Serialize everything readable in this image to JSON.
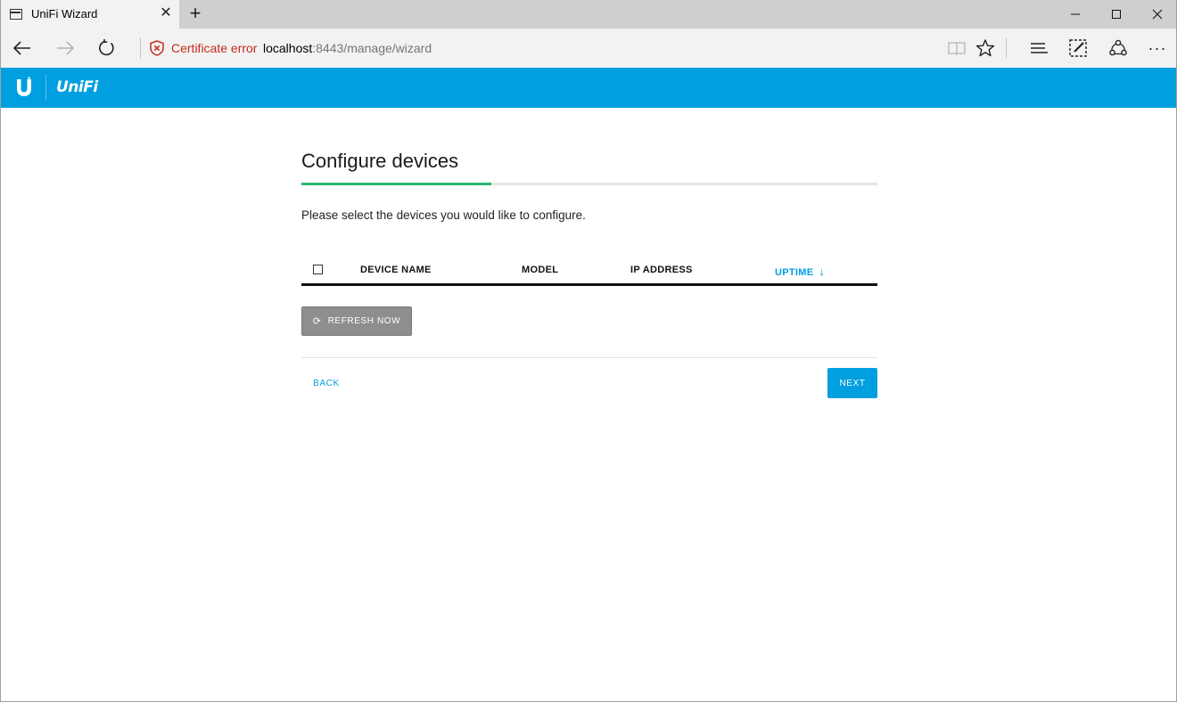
{
  "browser": {
    "tab_title": "UniFi Wizard",
    "tab_close": "✕",
    "new_tab": "+",
    "certificate_error": "Certificate error",
    "url_host": "localhost",
    "url_rest": ":8443/manage/wizard",
    "more": "···"
  },
  "header": {
    "brand": "UniFi",
    "accent_color": "#009fdf"
  },
  "wizard": {
    "title": "Configure devices",
    "progress": 0.33,
    "progress_color": "#2bb673",
    "description": "Please select the devices you would like to configure.",
    "columns": {
      "device_name": "DEVICE NAME",
      "model": "MODEL",
      "ip_address": "IP ADDRESS",
      "uptime": "UPTIME",
      "uptime_sort_arrow": "↓"
    },
    "refresh_icon": "⟳",
    "refresh_label": "REFRESH NOW",
    "back_label": "BACK",
    "next_label": "NEXT"
  }
}
